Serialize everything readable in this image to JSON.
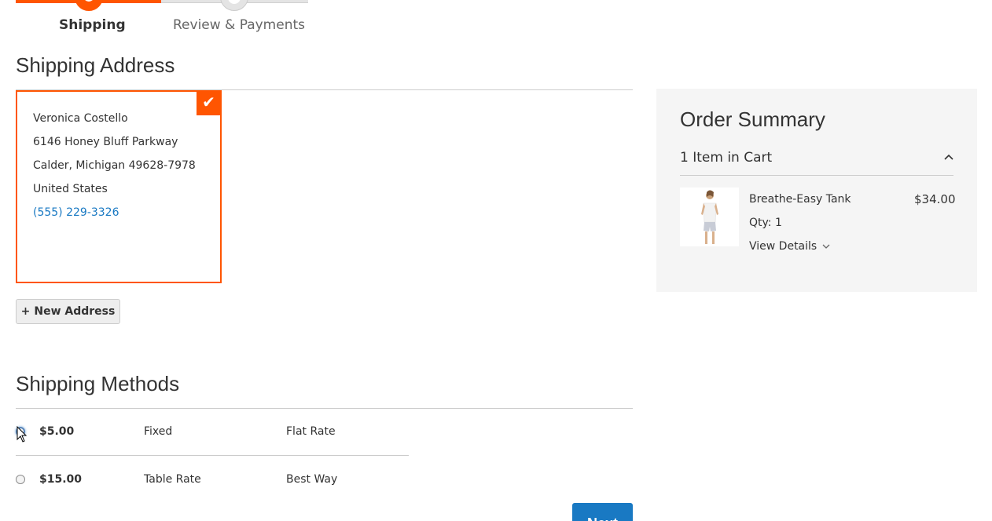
{
  "progress": {
    "steps": [
      {
        "label": "Shipping",
        "state": "active"
      },
      {
        "label": "Review & Payments",
        "state": "inactive"
      }
    ]
  },
  "shipping_address": {
    "title": "Shipping Address",
    "card": {
      "name": "Veronica Costello",
      "street": "6146 Honey Bluff Parkway",
      "city_line": "Calder, Michigan 49628-7978",
      "country": "United States",
      "phone": "(555) 229-3326",
      "selected": true
    },
    "new_address_label": "New Address",
    "new_address_icon": "+"
  },
  "shipping_methods": {
    "title": "Shipping Methods",
    "rows": [
      {
        "price": "$5.00",
        "method": "Fixed",
        "carrier": "Flat Rate",
        "selected": true
      },
      {
        "price": "$15.00",
        "method": "Table Rate",
        "carrier": "Best Way",
        "selected": false
      }
    ],
    "next_label": "Next"
  },
  "order_summary": {
    "title": "Order Summary",
    "items_count_label": "1 Item in Cart",
    "item": {
      "name": "Breathe-Easy Tank",
      "price": "$34.00",
      "qty": "Qty: 1",
      "view_details": "View Details"
    }
  },
  "colors": {
    "accent": "#ff5501",
    "link": "#1979c3",
    "summary_bg": "#f5f5f5"
  }
}
